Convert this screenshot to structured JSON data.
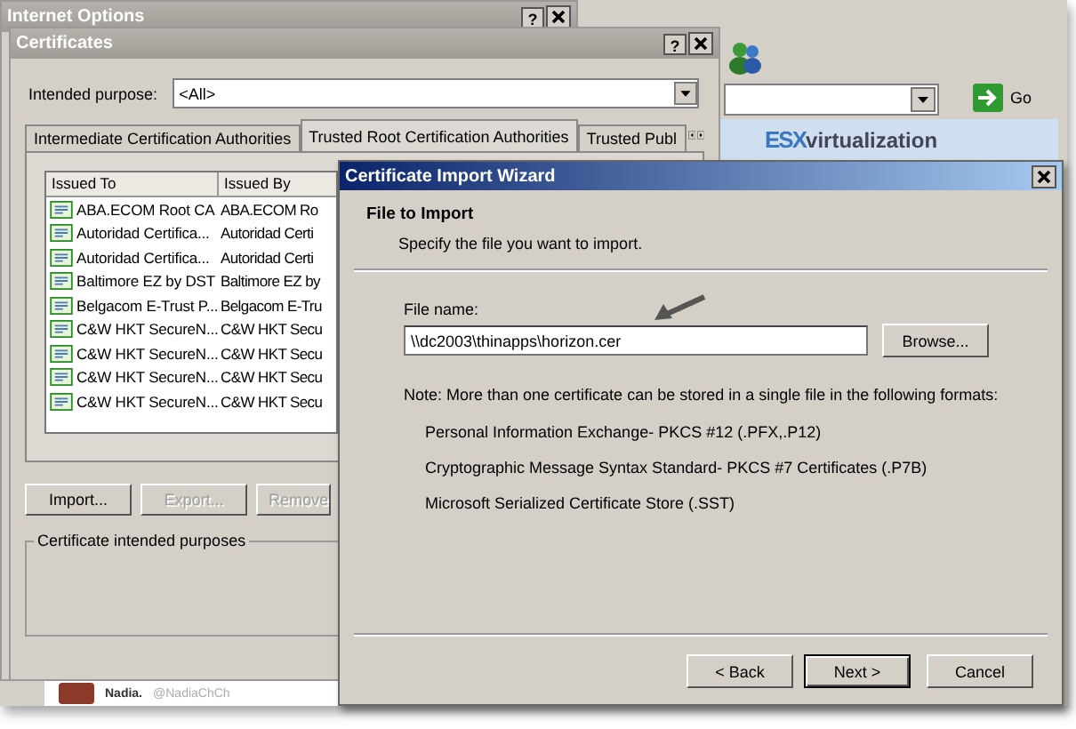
{
  "browser": {
    "go_button": "Go",
    "banner": {
      "brand_left": "ESX",
      "brand_right": "virtualization"
    },
    "tweet": {
      "name": "Nadia.",
      "handle": "@NadiaChCh"
    }
  },
  "internet_options": {
    "title": "Internet Options",
    "help_glyph": "?"
  },
  "certificates": {
    "title": "Certificates",
    "help_glyph": "?",
    "purpose_label": "Intended purpose:",
    "purpose_value": "<All>",
    "tabs": [
      {
        "label": "Intermediate Certification Authorities",
        "selected": false
      },
      {
        "label": "Trusted Root Certification Authorities",
        "selected": true
      },
      {
        "label": "Trusted Publ",
        "selected": false
      }
    ],
    "columns": [
      "Issued To",
      "Issued By"
    ],
    "rows": [
      {
        "issued_to": "ABA.ECOM Root CA",
        "issued_by": "ABA.ECOM Ro"
      },
      {
        "issued_to": "Autoridad Certifica...",
        "issued_by": "Autoridad Certi"
      },
      {
        "issued_to": "Autoridad Certifica...",
        "issued_by": "Autoridad Certi"
      },
      {
        "issued_to": "Baltimore EZ by DST",
        "issued_by": "Baltimore EZ by"
      },
      {
        "issued_to": "Belgacom E-Trust P...",
        "issued_by": "Belgacom E-Tru"
      },
      {
        "issued_to": "C&W HKT SecureN...",
        "issued_by": "C&W HKT Secu"
      },
      {
        "issued_to": "C&W HKT SecureN...",
        "issued_by": "C&W HKT Secu"
      },
      {
        "issued_to": "C&W HKT SecureN...",
        "issued_by": "C&W HKT Secu"
      },
      {
        "issued_to": "C&W HKT SecureN...",
        "issued_by": "C&W HKT Secu"
      }
    ],
    "buttons": [
      {
        "label": "Import...",
        "disabled": false
      },
      {
        "label": "Export...",
        "disabled": true
      },
      {
        "label": "Remove",
        "disabled": true
      }
    ],
    "group_label": "Certificate intended purposes"
  },
  "wizard": {
    "title": "Certificate Import Wizard",
    "heading": "File to Import",
    "subheading": "Specify the file you want to import.",
    "file_label": "File name:",
    "file_value": "\\\\dc2003\\thinapps\\horizon.cer",
    "browse_button": "Browse...",
    "note": "Note:  More than one certificate can be stored in a single file in the following formats:",
    "formats": [
      "Personal Information Exchange- PKCS #12 (.PFX,.P12)",
      "Cryptographic Message Syntax Standard- PKCS #7 Certificates (.P7B)",
      "Microsoft Serialized Certificate Store (.SST)"
    ],
    "buttons": [
      {
        "label": "< Back",
        "default": false
      },
      {
        "label": "Next >",
        "default": true
      },
      {
        "label": "Cancel",
        "default": false
      }
    ]
  }
}
